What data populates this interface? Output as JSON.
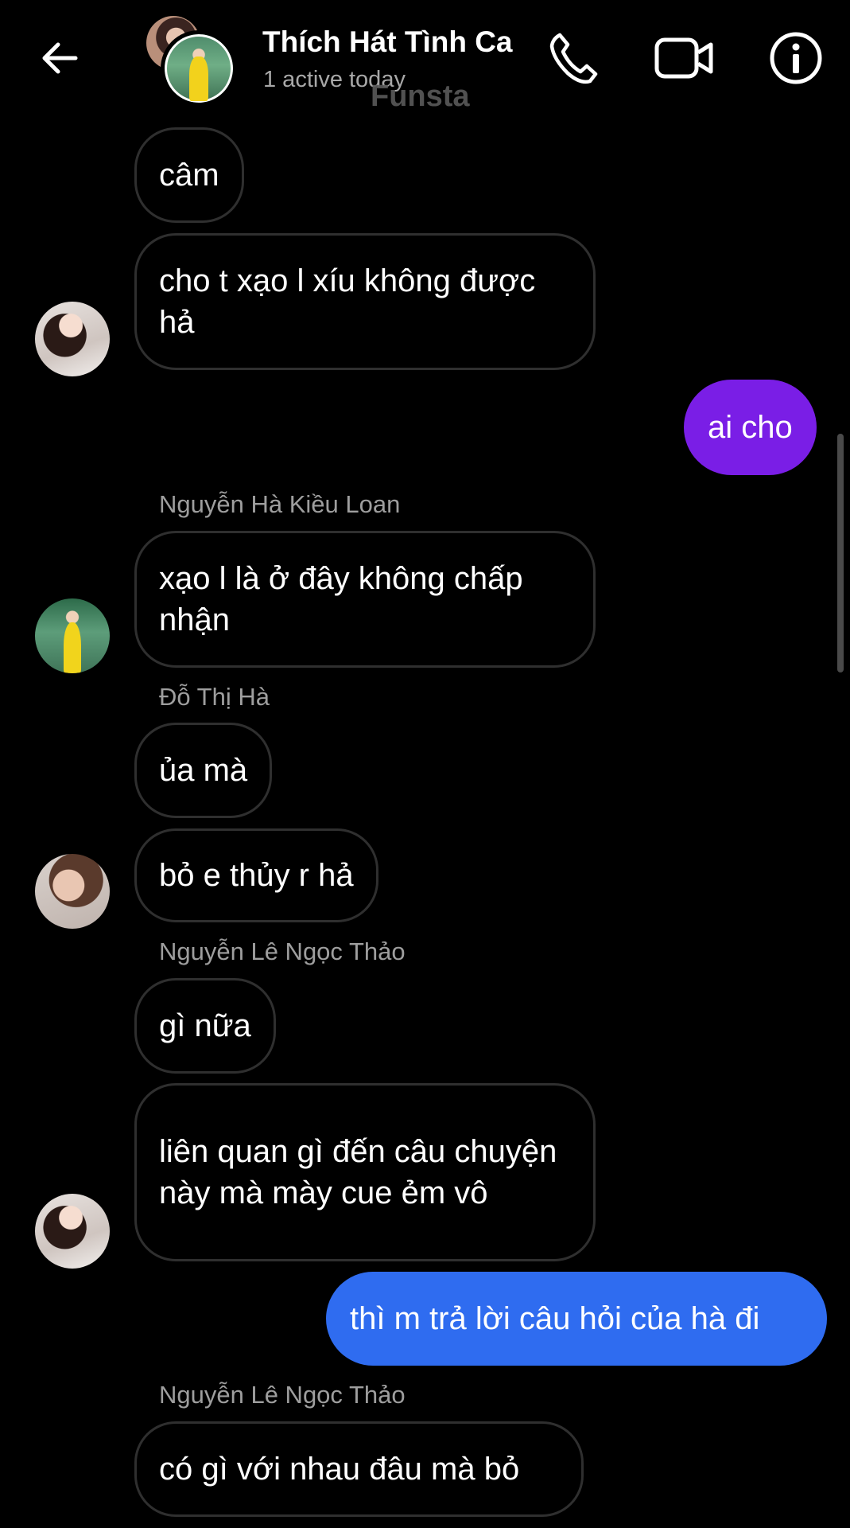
{
  "header": {
    "title": "Thích Hát Tình Ca",
    "status": "1 active today",
    "watermark": "Funsta"
  },
  "messages": {
    "m1": "câm",
    "m2": "cho t xạo l xíu không được hả",
    "m3": "ai cho",
    "s1": "Nguyễn Hà Kiều Loan",
    "m4": "xạo l là ở đây không chấp nhận",
    "s2": "Đỗ Thị Hà",
    "m5": "ủa mà",
    "m6": "bỏ e thủy r hả",
    "s3": "Nguyễn Lê Ngọc Thảo",
    "m7": "gì nữa",
    "m8": "liên quan gì đến câu chuyện này mà mày cue ẻm vô",
    "m9": "thì m trả lời câu hỏi của hà đi",
    "s4": "Nguyễn Lê Ngọc Thảo",
    "m10": "có gì với nhau đâu mà bỏ"
  },
  "colors": {
    "background": "#000000",
    "incoming_border": "#2f2f2f",
    "outgoing_purple": "#7a1ee6",
    "outgoing_blue": "#2f6cf0",
    "sender_name": "#9e9e9e"
  },
  "icons": {
    "back": "arrow-left-icon",
    "call": "phone-icon",
    "video": "video-camera-icon",
    "info": "info-icon"
  }
}
